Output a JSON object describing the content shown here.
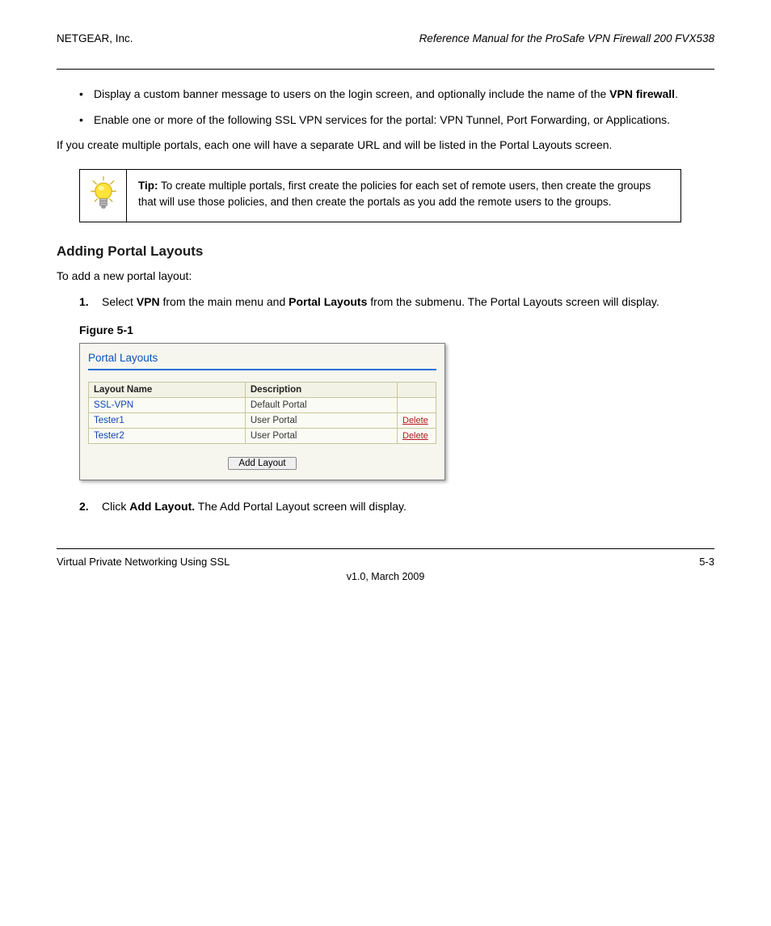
{
  "header": {
    "title": "Reference Manual for the ProSafe VPN Firewall 200 FVX538",
    "label_right": "NETGEAR, Inc."
  },
  "bullets": {
    "b1_prefix": "Display a custom banner message to users on the login screen, and optionally include the name of the ",
    "b1_bold": "VPN firewall",
    "b1_suffix": ".",
    "b2": "Enable one or more of the following SSL VPN services for the portal: VPN Tunnel, Port Forwarding, or Applications."
  },
  "para_after_bullets": "If you create multiple portals, each one will have a separate URL and will be listed in the Portal Layouts screen.",
  "tip": {
    "label": "Tip:",
    "text": " To create multiple portals, first create the policies for each set of remote users, then create the groups that will use those policies, and then create the portals as you add the remote users to the groups."
  },
  "h3": "Adding Portal Layouts",
  "h3_para": "To add a new portal layout:",
  "steps": {
    "s1_n": "1.",
    "s1_t_a": "Select ",
    "s1_t_b": "VPN ",
    "s1_t_c": "from the main menu and ",
    "s1_t_d": "Portal Layouts",
    "s1_t_e": " from the submenu. The Portal Layouts screen will display.",
    "fig_label": "Figure 5-1"
  },
  "screenshot": {
    "panel_title": "Portal Layouts",
    "headers": {
      "name": "Layout Name",
      "desc": "Description"
    },
    "rows": [
      {
        "name": "SSL-VPN",
        "desc": "Default Portal",
        "action": ""
      },
      {
        "name": "Tester1",
        "desc": "User Portal",
        "action": "Delete"
      },
      {
        "name": "Tester2",
        "desc": "User Portal",
        "action": "Delete"
      }
    ],
    "add_button": "Add Layout"
  },
  "step2": {
    "n": "2.",
    "a": "Click ",
    "b": "Add Layout.",
    "c": " The Add Portal Layout screen will display."
  },
  "footer": {
    "left": "Virtual Private Networking Using SSL",
    "right": "5-3",
    "version": "v1.0, March 2009"
  }
}
